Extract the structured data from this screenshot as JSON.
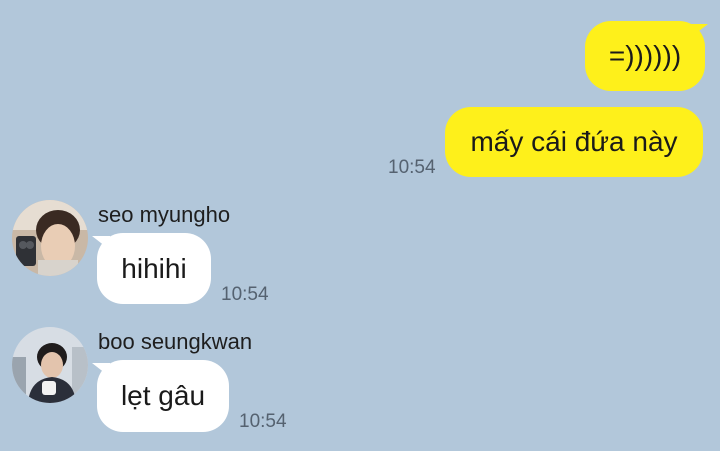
{
  "messages": {
    "outgoing_1": {
      "text": "=))))))"
    },
    "outgoing_2": {
      "text": "mấy cái đứa này",
      "time": "10:54"
    },
    "incoming_1": {
      "sender": "seo myungho",
      "text": "hihihi",
      "time": "10:54",
      "avatar": "profile-photo"
    },
    "incoming_2": {
      "sender": "boo seungkwan",
      "text": "lẹt gâu",
      "time": "10:54",
      "avatar": "profile-photo"
    }
  },
  "colors": {
    "background": "#b2c7da",
    "outgoing_bubble": "#fef01b",
    "incoming_bubble": "#ffffff",
    "timestamp": "#556270"
  }
}
